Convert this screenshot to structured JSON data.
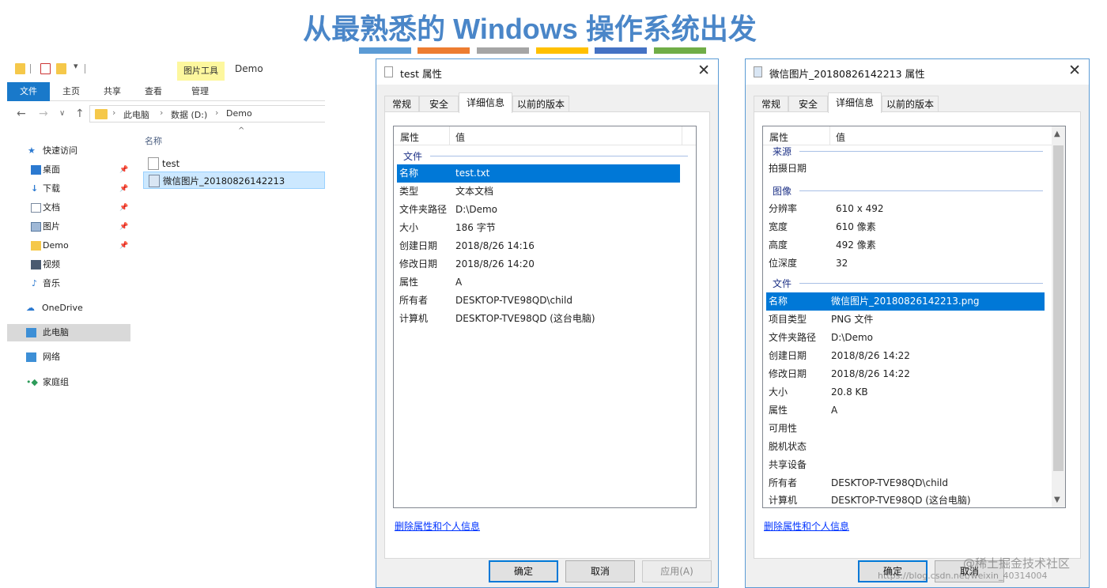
{
  "slide": {
    "title": "从最熟悉的 Windows 操作系统出发",
    "bar_colors": [
      "#5b9bd5",
      "#ed7d31",
      "#a5a5a5",
      "#ffc000",
      "#4472c4",
      "#70ad47"
    ]
  },
  "explorer": {
    "context_tab": "图片工具",
    "window_title": "Demo",
    "ribbon_tabs": [
      "文件",
      "主页",
      "共享",
      "查看",
      "管理"
    ],
    "breadcrumb": [
      "此电脑",
      "数据 (D:)",
      "Demo"
    ],
    "nav": {
      "quick_access": "快速访问",
      "items": [
        {
          "label": "桌面",
          "icon": "desktop-icon"
        },
        {
          "label": "下载",
          "icon": "download-icon"
        },
        {
          "label": "文档",
          "icon": "documents-icon"
        },
        {
          "label": "图片",
          "icon": "pictures-icon"
        },
        {
          "label": "Demo",
          "icon": "folder-icon"
        },
        {
          "label": "视频",
          "icon": "videos-icon"
        },
        {
          "label": "音乐",
          "icon": "music-icon"
        }
      ],
      "onedrive": "OneDrive",
      "this_pc": "此电脑",
      "network": "网络",
      "homegroup": "家庭组"
    },
    "column_header": "名称",
    "files": [
      "test",
      "微信图片_20180826142213"
    ]
  },
  "dialog1": {
    "title": "test 属性",
    "tabs": [
      "常规",
      "安全",
      "详细信息",
      "以前的版本"
    ],
    "header": {
      "property": "属性",
      "value": "值"
    },
    "group_file": "文件",
    "rows": [
      {
        "k": "名称",
        "v": "test.txt"
      },
      {
        "k": "类型",
        "v": "文本文档"
      },
      {
        "k": "文件夹路径",
        "v": "D:\\Demo"
      },
      {
        "k": "大小",
        "v": "186 字节"
      },
      {
        "k": "创建日期",
        "v": "2018/8/26 14:16"
      },
      {
        "k": "修改日期",
        "v": "2018/8/26 14:20"
      },
      {
        "k": "属性",
        "v": "A"
      },
      {
        "k": "所有者",
        "v": "DESKTOP-TVE98QD\\child"
      },
      {
        "k": "计算机",
        "v": "DESKTOP-TVE98QD (这台电脑)"
      }
    ],
    "link": "删除属性和个人信息",
    "buttons": {
      "ok": "确定",
      "cancel": "取消",
      "apply": "应用(A)"
    }
  },
  "dialog2": {
    "title": "微信图片_20180826142213 属性",
    "tabs": [
      "常规",
      "安全",
      "详细信息",
      "以前的版本"
    ],
    "header": {
      "property": "属性",
      "value": "值"
    },
    "group_source": "来源",
    "row_capture": {
      "k": "拍摄日期",
      "v": ""
    },
    "group_image": "图像",
    "image_rows": [
      {
        "k": "分辨率",
        "v": "610 x 492"
      },
      {
        "k": "宽度",
        "v": "610 像素"
      },
      {
        "k": "高度",
        "v": "492 像素"
      },
      {
        "k": "位深度",
        "v": "32"
      }
    ],
    "group_file": "文件",
    "file_rows": [
      {
        "k": "名称",
        "v": "微信图片_20180826142213.png"
      },
      {
        "k": "项目类型",
        "v": "PNG 文件"
      },
      {
        "k": "文件夹路径",
        "v": "D:\\Demo"
      },
      {
        "k": "创建日期",
        "v": "2018/8/26 14:22"
      },
      {
        "k": "修改日期",
        "v": "2018/8/26 14:22"
      },
      {
        "k": "大小",
        "v": "20.8 KB"
      },
      {
        "k": "属性",
        "v": "A"
      },
      {
        "k": "可用性",
        "v": ""
      },
      {
        "k": "脱机状态",
        "v": ""
      },
      {
        "k": "共享设备",
        "v": ""
      },
      {
        "k": "所有者",
        "v": "DESKTOP-TVE98QD\\child"
      },
      {
        "k": "计算机",
        "v": "DESKTOP-TVE98QD (这台电脑)"
      }
    ],
    "link": "删除属性和个人信息",
    "buttons": {
      "ok": "确定",
      "cancel": "取消"
    }
  },
  "watermark": {
    "site": "@稀土掘金技术社区",
    "url": "https://blog.csdn.net/weixin_40314004"
  }
}
